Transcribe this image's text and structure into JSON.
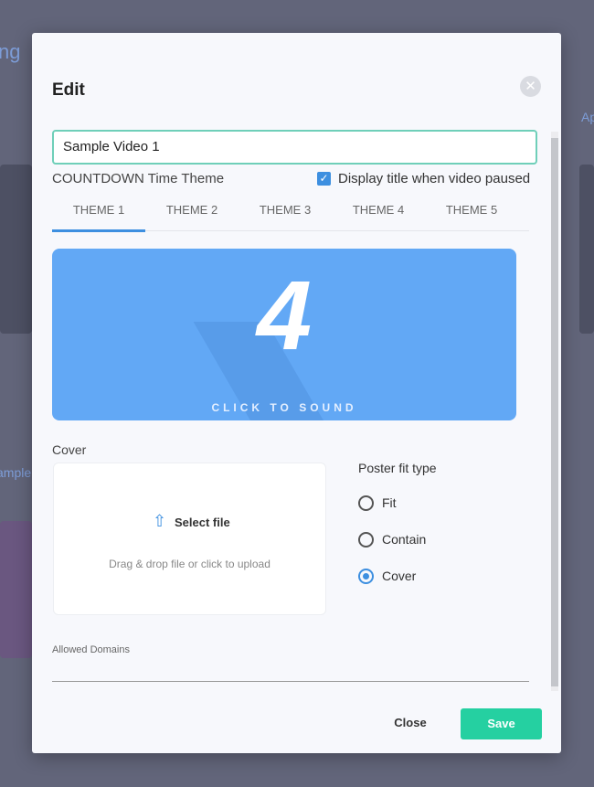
{
  "background": {
    "fragment_1": "ng",
    "fragment_2": "Ap",
    "fragment_3": "ample"
  },
  "modal": {
    "title": "Edit",
    "close_icon": "close-circle-icon",
    "title_input": {
      "value": "Sample Video 1"
    },
    "countdown_label": "COUNTDOWN Time Theme",
    "display_title_checkbox": {
      "label": "Display title when video paused",
      "checked": true
    },
    "tabs": [
      {
        "label": "THEME 1",
        "active": true
      },
      {
        "label": "THEME 2",
        "active": false
      },
      {
        "label": "THEME 3",
        "active": false
      },
      {
        "label": "THEME 4",
        "active": false
      },
      {
        "label": "THEME 5",
        "active": false
      }
    ],
    "preview": {
      "digit": "4",
      "caption": "CLICK TO SOUND",
      "color": "#62a8f5"
    },
    "cover": {
      "label": "Cover",
      "select_file": "Select file",
      "hint": "Drag & drop file or click to upload",
      "icon": "upload-icon"
    },
    "poster_fit": {
      "label": "Poster fit type",
      "options": [
        {
          "label": "Fit",
          "selected": false
        },
        {
          "label": "Contain",
          "selected": false
        },
        {
          "label": "Cover",
          "selected": true
        }
      ]
    },
    "allowed_domains": {
      "label": "Allowed Domains",
      "value": ""
    },
    "buttons": {
      "close": "Close",
      "save": "Save"
    },
    "colors": {
      "accent": "#3d8fe0",
      "save": "#25d0a1",
      "input_border": "#6fcfb9"
    }
  }
}
